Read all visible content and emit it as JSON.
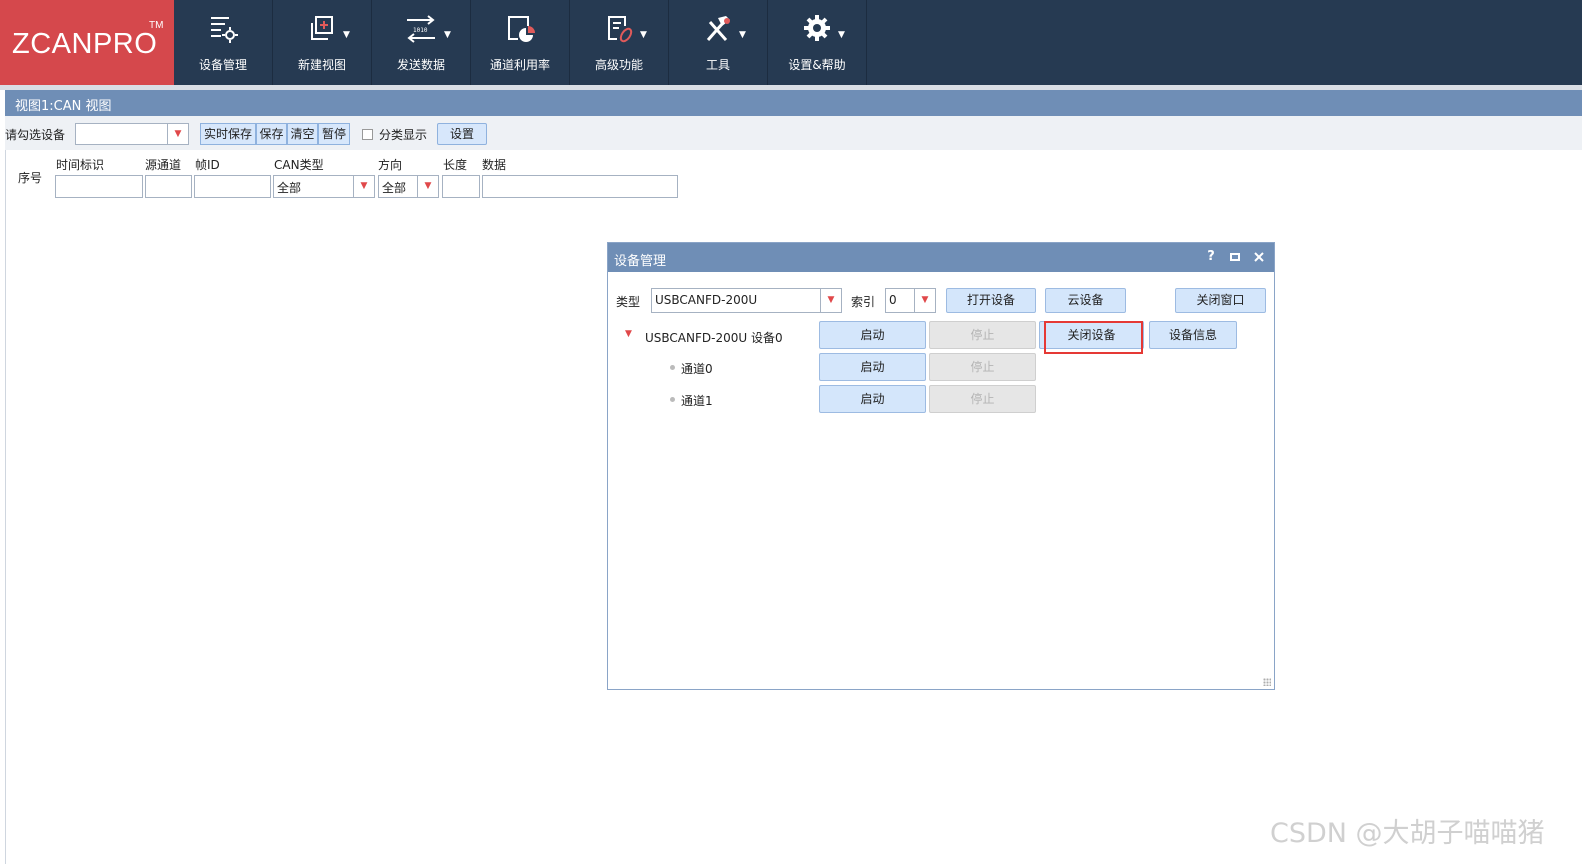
{
  "app": {
    "logo": "ZCANPRO",
    "logo_tm": "TM"
  },
  "ribbon": {
    "items": [
      {
        "label": "设备管理",
        "icon": "device-manage-icon",
        "caret": false
      },
      {
        "label": "新建视图",
        "icon": "new-view-icon",
        "caret": true
      },
      {
        "label": "发送数据",
        "icon": "send-data-icon",
        "caret": true
      },
      {
        "label": "通道利用率",
        "icon": "channel-usage-icon",
        "caret": false
      },
      {
        "label": "高级功能",
        "icon": "advanced-icon",
        "caret": true
      },
      {
        "label": "工具",
        "icon": "tools-icon",
        "caret": true
      },
      {
        "label": "设置&帮助",
        "icon": "gear-icon",
        "caret": true
      }
    ]
  },
  "view": {
    "title": "视图1:CAN 视图",
    "toolbar": {
      "device_label": "请勾选设备",
      "device_value": "",
      "realtime_save": "实时保存",
      "save": "保存",
      "clear": "清空",
      "pause": "暂停",
      "category_display": "分类显示",
      "settings": "设置"
    },
    "filter": {
      "index": "序号",
      "timestamp": "时间标识",
      "source_channel": "源通道",
      "frame_id": "帧ID",
      "can_type": "CAN类型",
      "can_type_value": "全部",
      "direction": "方向",
      "direction_value": "全部",
      "length": "长度",
      "data": "数据"
    }
  },
  "dialog": {
    "title": "设备管理",
    "help": "?",
    "type_label": "类型",
    "type_value": "USBCANFD-200U",
    "index_label": "索引",
    "index_value": "0",
    "open_device": "打开设备",
    "cloud_device": "云设备",
    "close_window": "关闭窗口",
    "device": {
      "name": "USBCANFD-200U 设备0",
      "start": "启动",
      "stop": "停止",
      "close_device": "关闭设备",
      "device_info": "设备信息"
    },
    "channels": [
      {
        "name": "通道0",
        "start": "启动",
        "stop": "停止"
      },
      {
        "name": "通道1",
        "start": "启动",
        "stop": "停止"
      }
    ]
  },
  "watermark": "CSDN @大胡子喵喵猪"
}
